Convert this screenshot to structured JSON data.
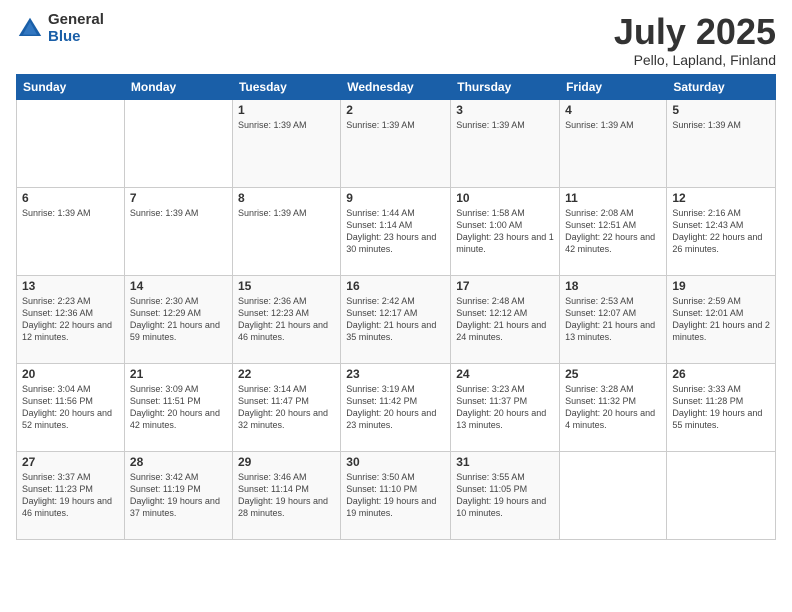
{
  "header": {
    "logo_general": "General",
    "logo_blue": "Blue",
    "title": "July 2025",
    "subtitle": "Pello, Lapland, Finland"
  },
  "weekdays": [
    "Sunday",
    "Monday",
    "Tuesday",
    "Wednesday",
    "Thursday",
    "Friday",
    "Saturday"
  ],
  "weeks": [
    [
      {
        "day": "",
        "info": ""
      },
      {
        "day": "",
        "info": ""
      },
      {
        "day": "1",
        "info": "Sunrise: 1:39 AM"
      },
      {
        "day": "2",
        "info": "Sunrise: 1:39 AM"
      },
      {
        "day": "3",
        "info": "Sunrise: 1:39 AM"
      },
      {
        "day": "4",
        "info": "Sunrise: 1:39 AM"
      },
      {
        "day": "5",
        "info": "Sunrise: 1:39 AM"
      }
    ],
    [
      {
        "day": "6",
        "info": "Sunrise: 1:39 AM"
      },
      {
        "day": "7",
        "info": "Sunrise: 1:39 AM"
      },
      {
        "day": "8",
        "info": "Sunrise: 1:39 AM"
      },
      {
        "day": "9",
        "info": "Sunrise: 1:44 AM\nSunset: 1:14 AM\nDaylight: 23 hours and 30 minutes."
      },
      {
        "day": "10",
        "info": "Sunrise: 1:58 AM\nSunset: 1:00 AM\nDaylight: 23 hours and 1 minute."
      },
      {
        "day": "11",
        "info": "Sunrise: 2:08 AM\nSunset: 12:51 AM\nDaylight: 22 hours and 42 minutes."
      },
      {
        "day": "12",
        "info": "Sunrise: 2:16 AM\nSunset: 12:43 AM\nDaylight: 22 hours and 26 minutes."
      }
    ],
    [
      {
        "day": "13",
        "info": "Sunrise: 2:23 AM\nSunset: 12:36 AM\nDaylight: 22 hours and 12 minutes."
      },
      {
        "day": "14",
        "info": "Sunrise: 2:30 AM\nSunset: 12:29 AM\nDaylight: 21 hours and 59 minutes."
      },
      {
        "day": "15",
        "info": "Sunrise: 2:36 AM\nSunset: 12:23 AM\nDaylight: 21 hours and 46 minutes."
      },
      {
        "day": "16",
        "info": "Sunrise: 2:42 AM\nSunset: 12:17 AM\nDaylight: 21 hours and 35 minutes."
      },
      {
        "day": "17",
        "info": "Sunrise: 2:48 AM\nSunset: 12:12 AM\nDaylight: 21 hours and 24 minutes."
      },
      {
        "day": "18",
        "info": "Sunrise: 2:53 AM\nSunset: 12:07 AM\nDaylight: 21 hours and 13 minutes."
      },
      {
        "day": "19",
        "info": "Sunrise: 2:59 AM\nSunset: 12:01 AM\nDaylight: 21 hours and 2 minutes."
      }
    ],
    [
      {
        "day": "20",
        "info": "Sunrise: 3:04 AM\nSunset: 11:56 PM\nDaylight: 20 hours and 52 minutes."
      },
      {
        "day": "21",
        "info": "Sunrise: 3:09 AM\nSunset: 11:51 PM\nDaylight: 20 hours and 42 minutes."
      },
      {
        "day": "22",
        "info": "Sunrise: 3:14 AM\nSunset: 11:47 PM\nDaylight: 20 hours and 32 minutes."
      },
      {
        "day": "23",
        "info": "Sunrise: 3:19 AM\nSunset: 11:42 PM\nDaylight: 20 hours and 23 minutes."
      },
      {
        "day": "24",
        "info": "Sunrise: 3:23 AM\nSunset: 11:37 PM\nDaylight: 20 hours and 13 minutes."
      },
      {
        "day": "25",
        "info": "Sunrise: 3:28 AM\nSunset: 11:32 PM\nDaylight: 20 hours and 4 minutes."
      },
      {
        "day": "26",
        "info": "Sunrise: 3:33 AM\nSunset: 11:28 PM\nDaylight: 19 hours and 55 minutes."
      }
    ],
    [
      {
        "day": "27",
        "info": "Sunrise: 3:37 AM\nSunset: 11:23 PM\nDaylight: 19 hours and 46 minutes."
      },
      {
        "day": "28",
        "info": "Sunrise: 3:42 AM\nSunset: 11:19 PM\nDaylight: 19 hours and 37 minutes."
      },
      {
        "day": "29",
        "info": "Sunrise: 3:46 AM\nSunset: 11:14 PM\nDaylight: 19 hours and 28 minutes."
      },
      {
        "day": "30",
        "info": "Sunrise: 3:50 AM\nSunset: 11:10 PM\nDaylight: 19 hours and 19 minutes."
      },
      {
        "day": "31",
        "info": "Sunrise: 3:55 AM\nSunset: 11:05 PM\nDaylight: 19 hours and 10 minutes."
      },
      {
        "day": "",
        "info": ""
      },
      {
        "day": "",
        "info": ""
      }
    ]
  ]
}
